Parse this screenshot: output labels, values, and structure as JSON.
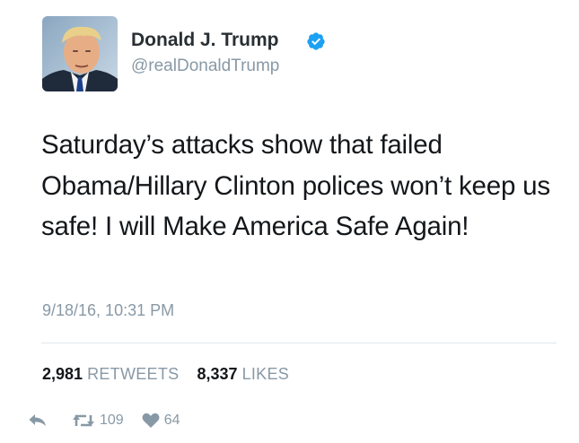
{
  "tweet": {
    "display_name": "Donald J. Trump",
    "verified": true,
    "handle": "@realDonaldTrump",
    "text": "Saturday’s attacks show that failed Obama/Hillary Clinton polices won’t keep us safe! I will Make America Safe Again!",
    "timestamp": "9/18/16, 10:31 PM"
  },
  "stats": {
    "retweets_count": "2,981",
    "retweets_label": "RETWEETS",
    "likes_count": "8,337",
    "likes_label": "LIKES"
  },
  "actions": {
    "reply_icon": "reply-icon",
    "retweet_icon": "retweet-icon",
    "retweet_count": "109",
    "like_icon": "heart-icon",
    "like_count": "64"
  },
  "colors": {
    "verified_badge": "#1da1f2",
    "secondary_text": "#8899a6",
    "primary_text": "#14171a",
    "divider": "#e1e8ed"
  }
}
